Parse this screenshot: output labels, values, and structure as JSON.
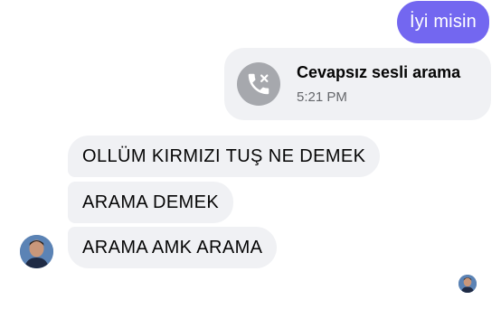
{
  "messages_outgoing": {
    "text": "İyi misin"
  },
  "missed_call": {
    "title": "Cevapsız sesli arama",
    "time": "5:21 PM",
    "icon": "missed-call-icon",
    "icon_bg": "#a6a8ad"
  },
  "messages_incoming": [
    {
      "text": "OLLÜM KIRMIZI TUŞ NE DEMEK"
    },
    {
      "text": "ARAMA DEMEK"
    },
    {
      "text": "ARAMA AMK ARAMA"
    }
  ],
  "colors": {
    "outgoing_bubble": "#7367f0",
    "incoming_bubble": "#f0f1f4",
    "text_dark": "#050505",
    "text_muted": "#65676b"
  }
}
